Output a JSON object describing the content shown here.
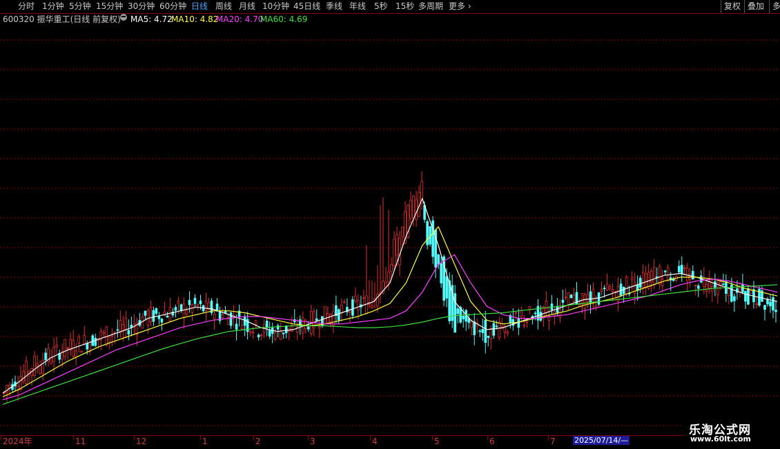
{
  "toolbar": {
    "periods": [
      "分时",
      "1分钟",
      "5分钟",
      "15分钟",
      "30分钟",
      "60分钟",
      "日线",
      "周线",
      "月线",
      "10分钟",
      "45日线",
      "季线",
      "年线",
      "5秒",
      "15秒",
      "多周期"
    ],
    "active_index": 6,
    "more_label": "更多",
    "more_icon": "chevron-right-icon",
    "right_buttons": [
      "复权",
      "叠加",
      "多"
    ]
  },
  "info": {
    "code_title": "600320 振华重工(日线 前复权)",
    "settings_icon": "gear-icon",
    "ma5": "MA5: 4.72",
    "ma10": "MA10: 4.82",
    "ma20": "MA20: 4.70",
    "ma60": "MA60: 4.69"
  },
  "colors": {
    "up": "#e03030",
    "down": "#54ffff",
    "ma5": "#ffffff",
    "ma10": "#ffff40",
    "ma20": "#ff40ff",
    "ma60": "#40e040",
    "grid": "#8b0000",
    "active_tab": "#4aa3ff"
  },
  "chart_data": {
    "type": "candlestick",
    "series": [
      {
        "name": "MA5",
        "values": [
          4.02,
          4.14,
          4.28,
          4.4,
          4.48,
          4.54,
          4.6,
          4.66,
          4.72,
          4.82,
          4.86,
          4.9,
          4.94,
          4.92,
          4.86,
          4.8,
          4.72,
          4.68,
          4.7,
          4.76,
          4.82,
          4.88,
          4.94,
          5.0,
          5.2,
          5.7,
          6.1,
          5.6,
          5.0,
          4.8,
          4.7,
          4.72,
          4.78,
          4.84,
          4.9,
          4.96,
          5.02,
          5.04,
          5.1,
          5.16,
          5.22,
          5.28,
          5.3,
          5.26,
          5.2,
          5.14,
          5.08,
          5.04,
          5.0
        ]
      },
      {
        "name": "MA10",
        "values": [
          3.98,
          4.06,
          4.16,
          4.26,
          4.36,
          4.44,
          4.52,
          4.58,
          4.64,
          4.7,
          4.76,
          4.82,
          4.86,
          4.9,
          4.9,
          4.88,
          4.84,
          4.8,
          4.76,
          4.74,
          4.76,
          4.8,
          4.84,
          4.9,
          4.98,
          5.2,
          5.6,
          5.8,
          5.4,
          5.0,
          4.8,
          4.76,
          4.78,
          4.82,
          4.86,
          4.9,
          4.96,
          5.0,
          5.04,
          5.1,
          5.16,
          5.22,
          5.26,
          5.26,
          5.24,
          5.2,
          5.14,
          5.1,
          5.06
        ]
      },
      {
        "name": "MA20",
        "values": [
          3.95,
          4.0,
          4.08,
          4.16,
          4.24,
          4.32,
          4.4,
          4.48,
          4.54,
          4.6,
          4.66,
          4.72,
          4.76,
          4.8,
          4.82,
          4.84,
          4.84,
          4.82,
          4.8,
          4.78,
          4.76,
          4.76,
          4.78,
          4.8,
          4.82,
          4.9,
          5.1,
          5.4,
          5.5,
          5.2,
          4.95,
          4.86,
          4.82,
          4.82,
          4.84,
          4.86,
          4.9,
          4.94,
          4.98,
          5.02,
          5.06,
          5.12,
          5.18,
          5.22,
          5.24,
          5.22,
          5.18,
          5.14,
          5.1
        ]
      },
      {
        "name": "MA60",
        "values": [
          3.9,
          3.96,
          4.02,
          4.08,
          4.14,
          4.2,
          4.26,
          4.32,
          4.38,
          4.44,
          4.5,
          4.55,
          4.6,
          4.64,
          4.68,
          4.7,
          4.72,
          4.73,
          4.74,
          4.74,
          4.74,
          4.73,
          4.72,
          4.72,
          4.73,
          4.75,
          4.78,
          4.82,
          4.85,
          4.86,
          4.87,
          4.88,
          4.9,
          4.92,
          4.94,
          4.96,
          4.98,
          5.0,
          5.02,
          5.04,
          5.06,
          5.08,
          5.1,
          5.12,
          5.14,
          5.15,
          5.16,
          5.17,
          5.18
        ]
      }
    ],
    "months": [
      "2024年",
      "11",
      "12",
      "1",
      "2",
      "3",
      "4",
      "5",
      "6",
      "7"
    ],
    "cursor_date": "2025/07/14/—"
  },
  "watermark": {
    "line1": "乐淘公式网",
    "line2": "www.60lt.com"
  }
}
